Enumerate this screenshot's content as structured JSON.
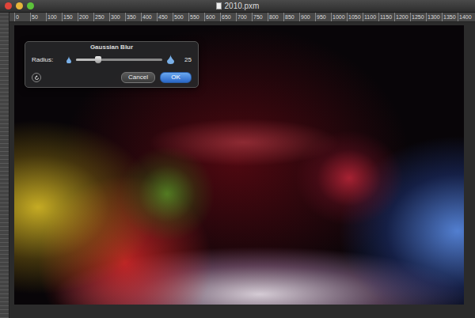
{
  "window": {
    "title": "2010.pxm"
  },
  "ruler": {
    "ticks": [
      "0",
      "50",
      "100",
      "150",
      "200",
      "250",
      "300",
      "350",
      "400",
      "450",
      "500",
      "550",
      "600",
      "650",
      "700",
      "750",
      "800",
      "850",
      "900",
      "950",
      "1000",
      "1050",
      "1100",
      "1150",
      "1200",
      "1250",
      "1300",
      "1350",
      "1400"
    ]
  },
  "dialog": {
    "title": "Gaussian Blur",
    "radius": {
      "label": "Radius:",
      "level": 0.26,
      "reading": "25"
    },
    "buttons": [
      {
        "label": "Cancel",
        "default": false
      },
      {
        "label": "OK",
        "default": true
      }
    ]
  }
}
